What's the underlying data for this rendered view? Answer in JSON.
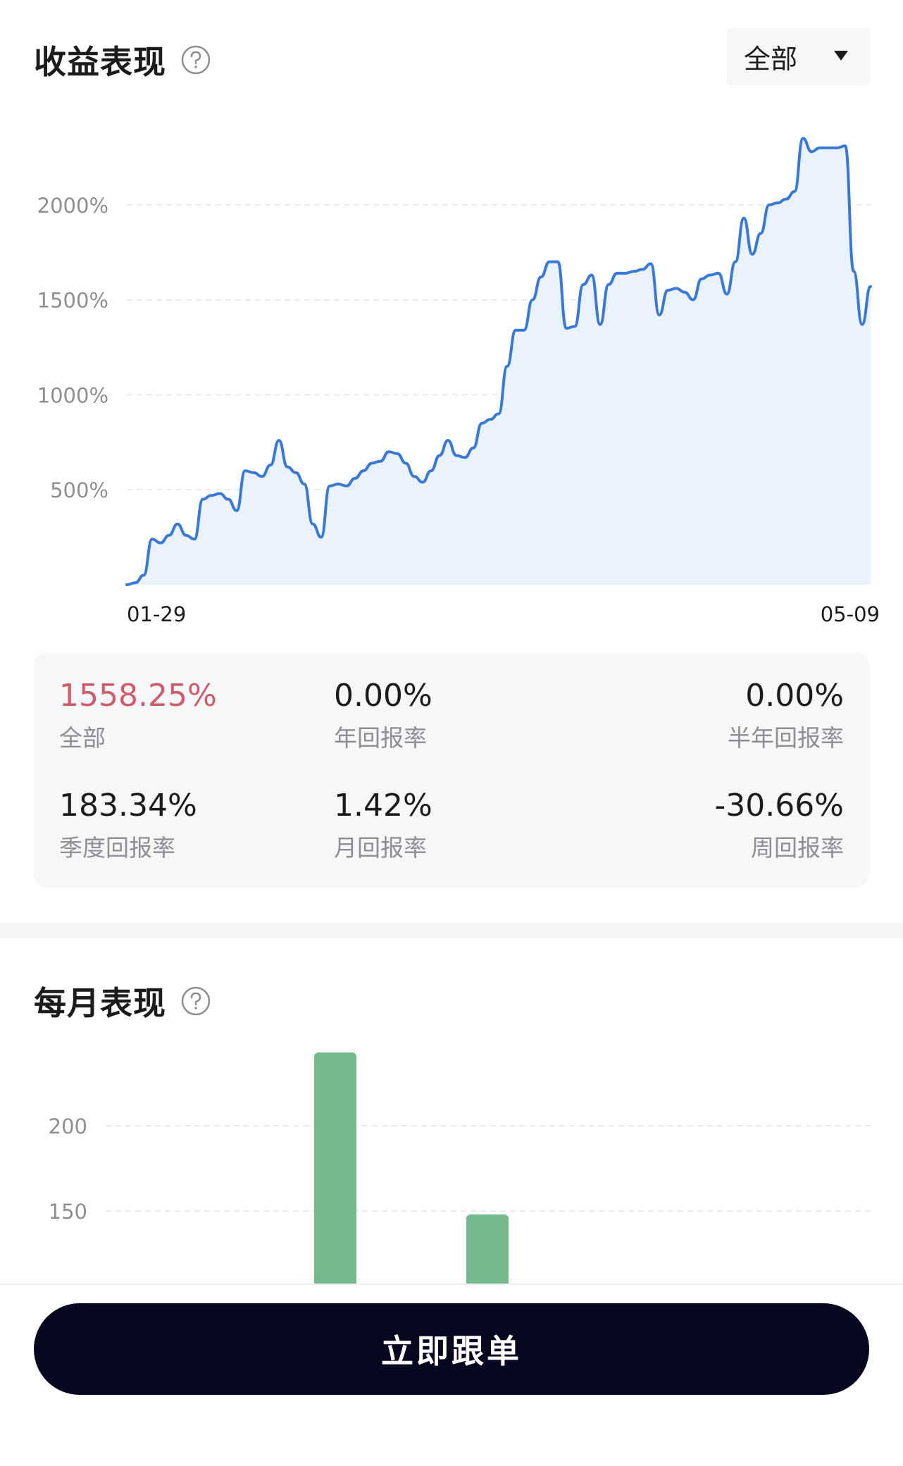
{
  "returns_section": {
    "title": "收益表现",
    "period_select": {
      "value": "全部"
    }
  },
  "stats": {
    "total": {
      "value": "1558.25%",
      "label": "全部"
    },
    "annual": {
      "value": "0.00%",
      "label": "年回报率"
    },
    "half_year": {
      "value": "0.00%",
      "label": "半年回报率"
    },
    "quarter": {
      "value": "183.34%",
      "label": "季度回报率"
    },
    "month": {
      "value": "1.42%",
      "label": "月回报率"
    },
    "week": {
      "value": "-30.66%",
      "label": "周回报率"
    }
  },
  "monthly_section": {
    "title": "每月表现"
  },
  "follow_button": {
    "label": "立即跟单"
  },
  "colors": {
    "line": "#3a78d6",
    "area": "#eaf2fd",
    "bar": "#77b98e",
    "highlight": "#cf5c6a",
    "button": "#070720"
  },
  "chart_data": [
    {
      "type": "area",
      "ylabel": "",
      "ylim": [
        0,
        2350
      ],
      "yticks": [
        500,
        1000,
        1500,
        2000
      ],
      "ytick_labels": [
        "500%",
        "1000%",
        "1500%",
        "2000%"
      ],
      "xtick_labels": [
        "01-29",
        "05-09"
      ],
      "grid": true,
      "series": [
        {
          "values": [
            0,
            10,
            50,
            240,
            220,
            260,
            320,
            260,
            240,
            450,
            470,
            480,
            450,
            390,
            600,
            590,
            570,
            630,
            760,
            620,
            590,
            530,
            320,
            250,
            520,
            530,
            520,
            560,
            600,
            640,
            650,
            700,
            690,
            640,
            570,
            540,
            600,
            680,
            760,
            680,
            670,
            720,
            850,
            870,
            900,
            1150,
            1340,
            1340,
            1500,
            1620,
            1700,
            1700,
            1350,
            1360,
            1580,
            1630,
            1370,
            1580,
            1640,
            1640,
            1650,
            1660,
            1690,
            1420,
            1550,
            1560,
            1540,
            1500,
            1610,
            1630,
            1640,
            1530,
            1700,
            1930,
            1740,
            1850,
            2000,
            2010,
            2030,
            2070,
            2350,
            2280,
            2300,
            2300,
            2300,
            2310,
            1650,
            1370,
            1570
          ]
        }
      ]
    },
    {
      "type": "bar",
      "ylabel": "",
      "yticks": [
        150,
        200
      ],
      "ytick_labels": [
        "150",
        "200"
      ],
      "grid": true,
      "bars": [
        {
          "x_index": 3,
          "value": 243
        },
        {
          "x_index": 5,
          "value": 148
        }
      ]
    }
  ]
}
